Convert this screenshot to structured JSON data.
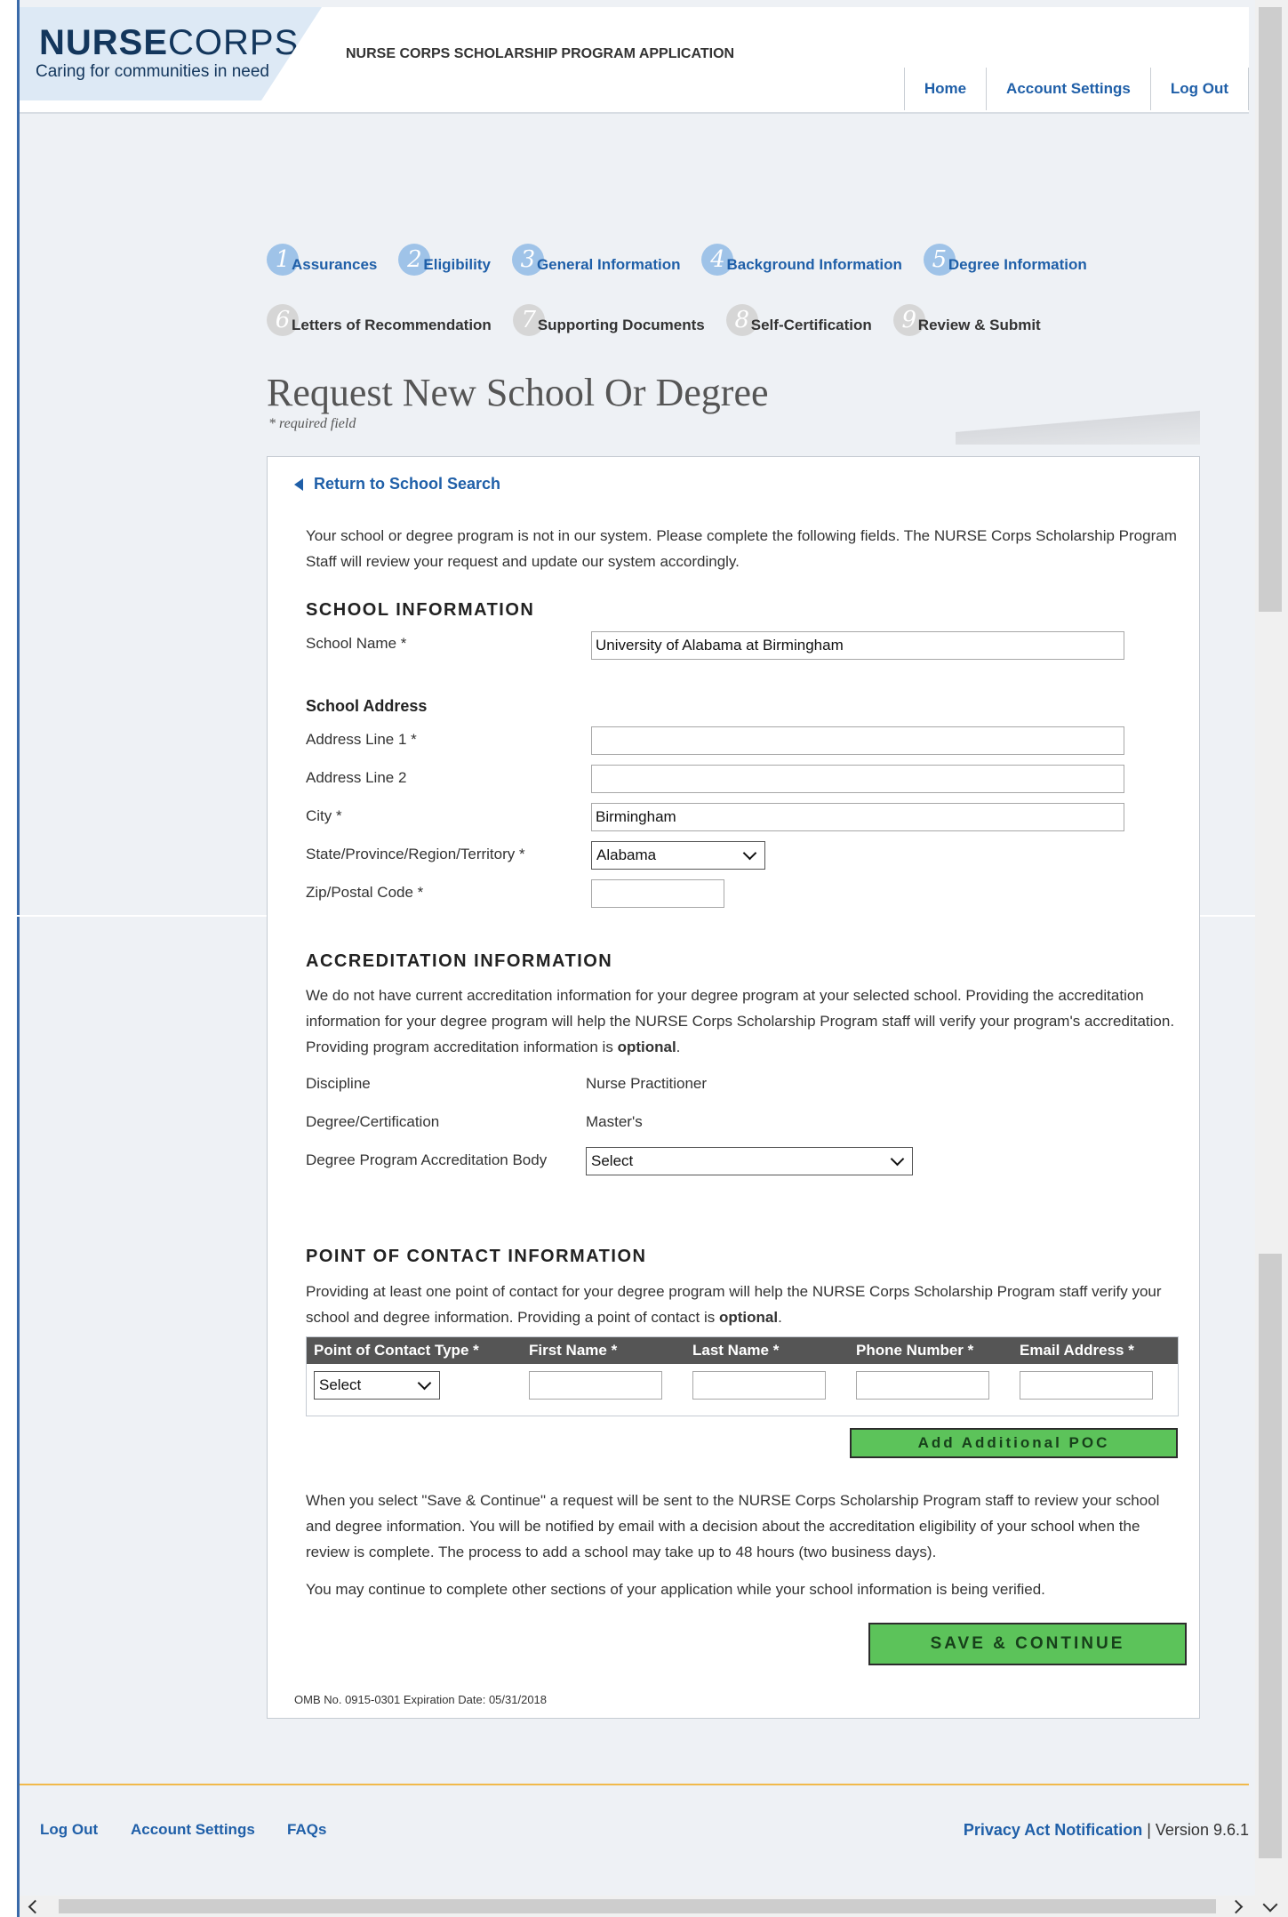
{
  "header": {
    "logo_nurse": "NURSE",
    "logo_corps": "CORPS",
    "logo_tagline": "Caring for communities in need",
    "app_title": "NURSE CORPS SCHOLARSHIP PROGRAM APPLICATION",
    "nav": [
      "Home",
      "Account Settings",
      "Log Out"
    ]
  },
  "steps": [
    {
      "num": "1",
      "label": "Assurances",
      "state": "active"
    },
    {
      "num": "2",
      "label": "Eligibility",
      "state": "active"
    },
    {
      "num": "3",
      "label": "General Information",
      "state": "active"
    },
    {
      "num": "4",
      "label": "Background Information",
      "state": "active"
    },
    {
      "num": "5",
      "label": "Degree Information",
      "state": "active"
    },
    {
      "num": "6",
      "label": "Letters of Recommendation",
      "state": "inactive"
    },
    {
      "num": "7",
      "label": "Supporting Documents",
      "state": "inactive"
    },
    {
      "num": "8",
      "label": "Self-Certification",
      "state": "inactive"
    },
    {
      "num": "9",
      "label": "Review & Submit",
      "state": "inactive"
    }
  ],
  "page": {
    "title": "Request New School Or Degree",
    "required_note": "* required field",
    "back_link": "Return to School Search",
    "intro": "Your school or degree program is not in our system. Please complete the following fields. The NURSE Corps Scholarship Program Staff will review your request and update our system accordingly."
  },
  "school": {
    "heading": "SCHOOL INFORMATION",
    "name_label": "School Name *",
    "name_value": "University of Alabama at Birmingham",
    "address_heading": "School Address",
    "addr1_label": "Address Line 1 *",
    "addr1_value": "",
    "addr2_label": "Address Line 2",
    "addr2_value": "",
    "city_label": "City *",
    "city_value": "Birmingham",
    "state_label": "State/Province/Region/Territory *",
    "state_value": "Alabama",
    "zip_label": "Zip/Postal Code *",
    "zip_value": ""
  },
  "accreditation": {
    "heading": "ACCREDITATION INFORMATION",
    "text_a": "We do not have current accreditation information for your degree program at your selected school. Providing the accreditation information for your degree program will help the NURSE Corps Scholarship Program staff will verify your program's accreditation. Providing program accreditation information is ",
    "text_bold": "optional",
    "text_end": ".",
    "discipline_label": "Discipline",
    "discipline_value": "Nurse Practitioner",
    "degree_label": "Degree/Certification",
    "degree_value": "Master's",
    "body_label": "Degree Program Accreditation Body",
    "body_value": "Select"
  },
  "poc": {
    "heading": "POINT OF CONTACT INFORMATION",
    "text_a": "Providing at least one point of contact for your degree program will help the NURSE Corps Scholarship Program staff verify your school and degree information. Providing a point of contact is ",
    "text_bold": "optional",
    "text_end": ".",
    "columns": [
      "Point of Contact Type *",
      "First Name *",
      "Last Name *",
      "Phone Number *",
      "Email Address *"
    ],
    "type_value": "Select",
    "add_button": "Add Additional POC"
  },
  "closing": {
    "para1": "When you select \"Save & Continue\" a request will be sent to the NURSE Corps Scholarship Program staff to review your school and degree information. You will be notified by email with a decision about the accreditation eligibility of your school when the review is complete. The process to add a school may take up to 48 hours (two business days).",
    "para2": "You may continue to complete other sections of your application while your school information is being verified.",
    "save_button": "SAVE & CONTINUE",
    "omb": "OMB No. 0915-0301 Expiration Date: 05/31/2018"
  },
  "footer": {
    "links": [
      "Log Out",
      "Account Settings",
      "FAQs"
    ],
    "privacy": "Privacy Act Notification",
    "version": " | Version 9.6.1"
  },
  "colors": {
    "link": "#1f5fa8",
    "button_green": "#5cc35a",
    "footer_rule": "#f1b94a"
  }
}
